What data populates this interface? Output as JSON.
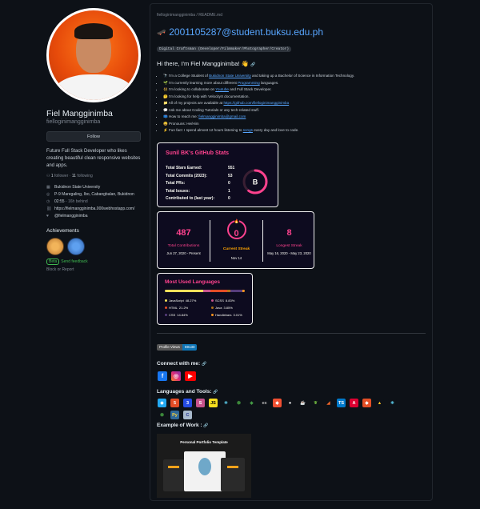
{
  "profile": {
    "name": "Fiel Mangginimba",
    "login": "fielloginimangginimba",
    "follow_label": "Follow",
    "bio": "Future Full Stack Developer who likes creating beautiful clean responsive websites and apps.",
    "followers": "1",
    "followers_label": "follower",
    "following": "11",
    "following_label": "following",
    "org": "Bukidnon State University",
    "location": "P-9 Maregaling, Ibo, Cabangbalan, Bukidnon",
    "time": "02:55",
    "time_note": "- 16h behind",
    "website": "https://fielmangginimba.000webhostapp.com/",
    "twitter": "@fielmangginimba",
    "achievements_label": "Achievements",
    "beta_tag": "Beta",
    "beta_label": "Send feedback",
    "block_label": "Block or Report"
  },
  "readme": {
    "path": "fielloginimangginimba / README.md",
    "email": "2001105287@student.buksu.edu.ph",
    "craftsman": "Digital Craftsman (Developer/Filmmaker/Photographer/Creator)",
    "greeting": "Hi there, I'm Fiel Mangginimba! 👋",
    "bullets": [
      {
        "pre": "I'm a College Student of ",
        "link": "Bukidnon State University",
        "post": " and taking up a Bachelor of Science in Information Technology."
      },
      {
        "pre": "I'm currently learning more about different ",
        "link": "Programming",
        "post": " languages."
      },
      {
        "pre": "I'm looking to collaborate on ",
        "link": "Youtube",
        "post": " and Full Stack Developer."
      },
      {
        "pre": "I'm looking for help with VelocityX documentation.",
        "link": "",
        "post": ""
      },
      {
        "pre": "All of my projects are available at ",
        "link": "https://github.com/fielloginimangginimba",
        "post": ""
      },
      {
        "pre": "Ask me about Coding Tutorials or any tech-related stuff.",
        "link": "",
        "post": ""
      },
      {
        "pre": "How to reach me: ",
        "link": "fielmangginimba@gmail.com",
        "post": ""
      },
      {
        "pre": "Pronouns: He/Him",
        "link": "",
        "post": ""
      },
      {
        "pre": "Fun fact: I spend almost 12 hours listening to ",
        "link": "songs",
        "post": " every day and love to code."
      }
    ],
    "bullet_icons": [
      "🔭",
      "🌱",
      "👯",
      "🤔",
      "📁",
      "💬",
      "📫",
      "😄",
      "⚡"
    ],
    "stats": {
      "title": "Sunil BK's GitHub Stats",
      "rows": [
        {
          "k": "Total Stars Earned:",
          "v": "551"
        },
        {
          "k": "Total Commits (2023):",
          "v": "53"
        },
        {
          "k": "Total PRs:",
          "v": "0"
        },
        {
          "k": "Total Issues:",
          "v": "1"
        },
        {
          "k": "Contributed to (last year):",
          "v": "0"
        }
      ],
      "grade": "B",
      "grade_progress": 0.6
    },
    "streak": {
      "total": "487",
      "total_label": "Total Contributions",
      "total_range": "Jun 27, 2020 - Present",
      "current": "0",
      "current_label": "Current Streak",
      "current_date": "Nov 14",
      "longest": "8",
      "longest_label": "Longest Streak",
      "longest_range": "May 16, 2020 - May 23, 2020"
    },
    "languages": {
      "title": "Most Used Languages",
      "items": [
        {
          "name": "JavaScript",
          "pct": "48.27%",
          "color": "#f1e05a"
        },
        {
          "name": "SCSS",
          "pct": "8.83%",
          "color": "#c6538c"
        },
        {
          "name": "HTML",
          "pct": "21.2%",
          "color": "#e34c26"
        },
        {
          "name": "Java",
          "pct": "3.85%",
          "color": "#b07219"
        },
        {
          "name": "CSS",
          "pct": "14.84%",
          "color": "#563d7c"
        },
        {
          "name": "Handlebars",
          "pct": "3.01%",
          "color": "#f7931e"
        }
      ]
    },
    "views_label": "Profile Views",
    "views_count": "69130",
    "connect_title": "Connect with me:",
    "tools_title": "Languages and Tools:",
    "work_title": "Example of Work :",
    "work_image_title": "Personal Portfolio Template"
  },
  "colors": {
    "accent": "#fe428e",
    "link": "#58a6ff",
    "bg": "#0d1117"
  }
}
